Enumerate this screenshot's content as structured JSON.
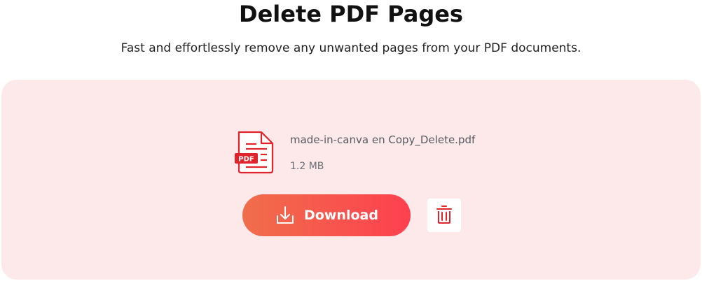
{
  "header": {
    "title": "Delete PDF Pages",
    "subtitle": "Fast and effortlessly remove any unwanted pages from your PDF documents."
  },
  "file": {
    "icon": "pdf-file-icon",
    "badge": "PDF",
    "name": "made-in-canva en Copy_Delete.pdf",
    "size": "1.2 MB"
  },
  "actions": {
    "download_label": "Download",
    "download_icon": "download-icon",
    "delete_icon": "trash-icon"
  },
  "colors": {
    "card_background": "#fee9ea",
    "accent_start": "#ef6e4b",
    "accent_end": "#fe404f",
    "pdf_red": "#e1232b"
  }
}
